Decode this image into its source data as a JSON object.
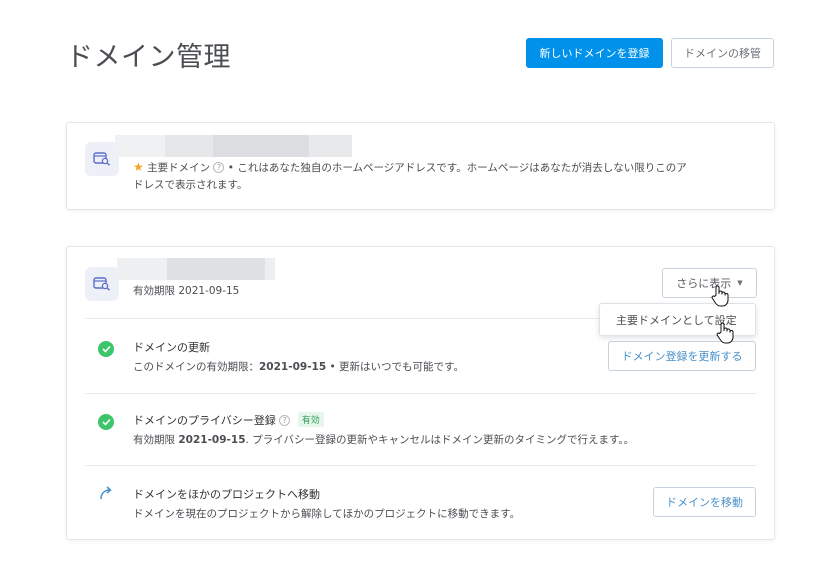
{
  "header": {
    "title": "ドメイン管理",
    "new_domain_button": "新しいドメインを登録",
    "transfer_button": "ドメインの移管"
  },
  "primary_card": {
    "primary_label": "主要ドメイン",
    "description_line1": "• これはあなた独自のホームページアドレスです。ホームページはあなたが消去しない限りこのア",
    "description_line2": "ドレスで表示されます。"
  },
  "domain_card": {
    "expiry_label": "有効期限 2021-09-15",
    "more_button": "さらに表示",
    "dropdown_item": "主要ドメインとして設定",
    "rows": [
      {
        "title": "ドメインの更新",
        "desc_prefix": "このドメインの有効期限：",
        "desc_date": "2021-09-15",
        "desc_suffix": " • 更新はいつでも可能です。",
        "button": "ドメイン登録を更新する"
      },
      {
        "title": "ドメインのプライバシー登録",
        "badge": "有効",
        "desc_prefix": "有効期限 ",
        "desc_date": "2021-09-15",
        "desc_suffix": ". プライバシー登録の更新やキャンセルはドメイン更新のタイミングで行えます。。"
      },
      {
        "title": "ドメインをほかのプロジェクトへ移動",
        "desc": "ドメインを現在のプロジェクトから解除してほかのプロジェクトに移動できます。",
        "button": "ドメインを移動"
      }
    ]
  },
  "colors": {
    "primary": "#0091ea",
    "success": "#3cc56a",
    "star": "#f5a623",
    "link": "#4a90c8"
  }
}
